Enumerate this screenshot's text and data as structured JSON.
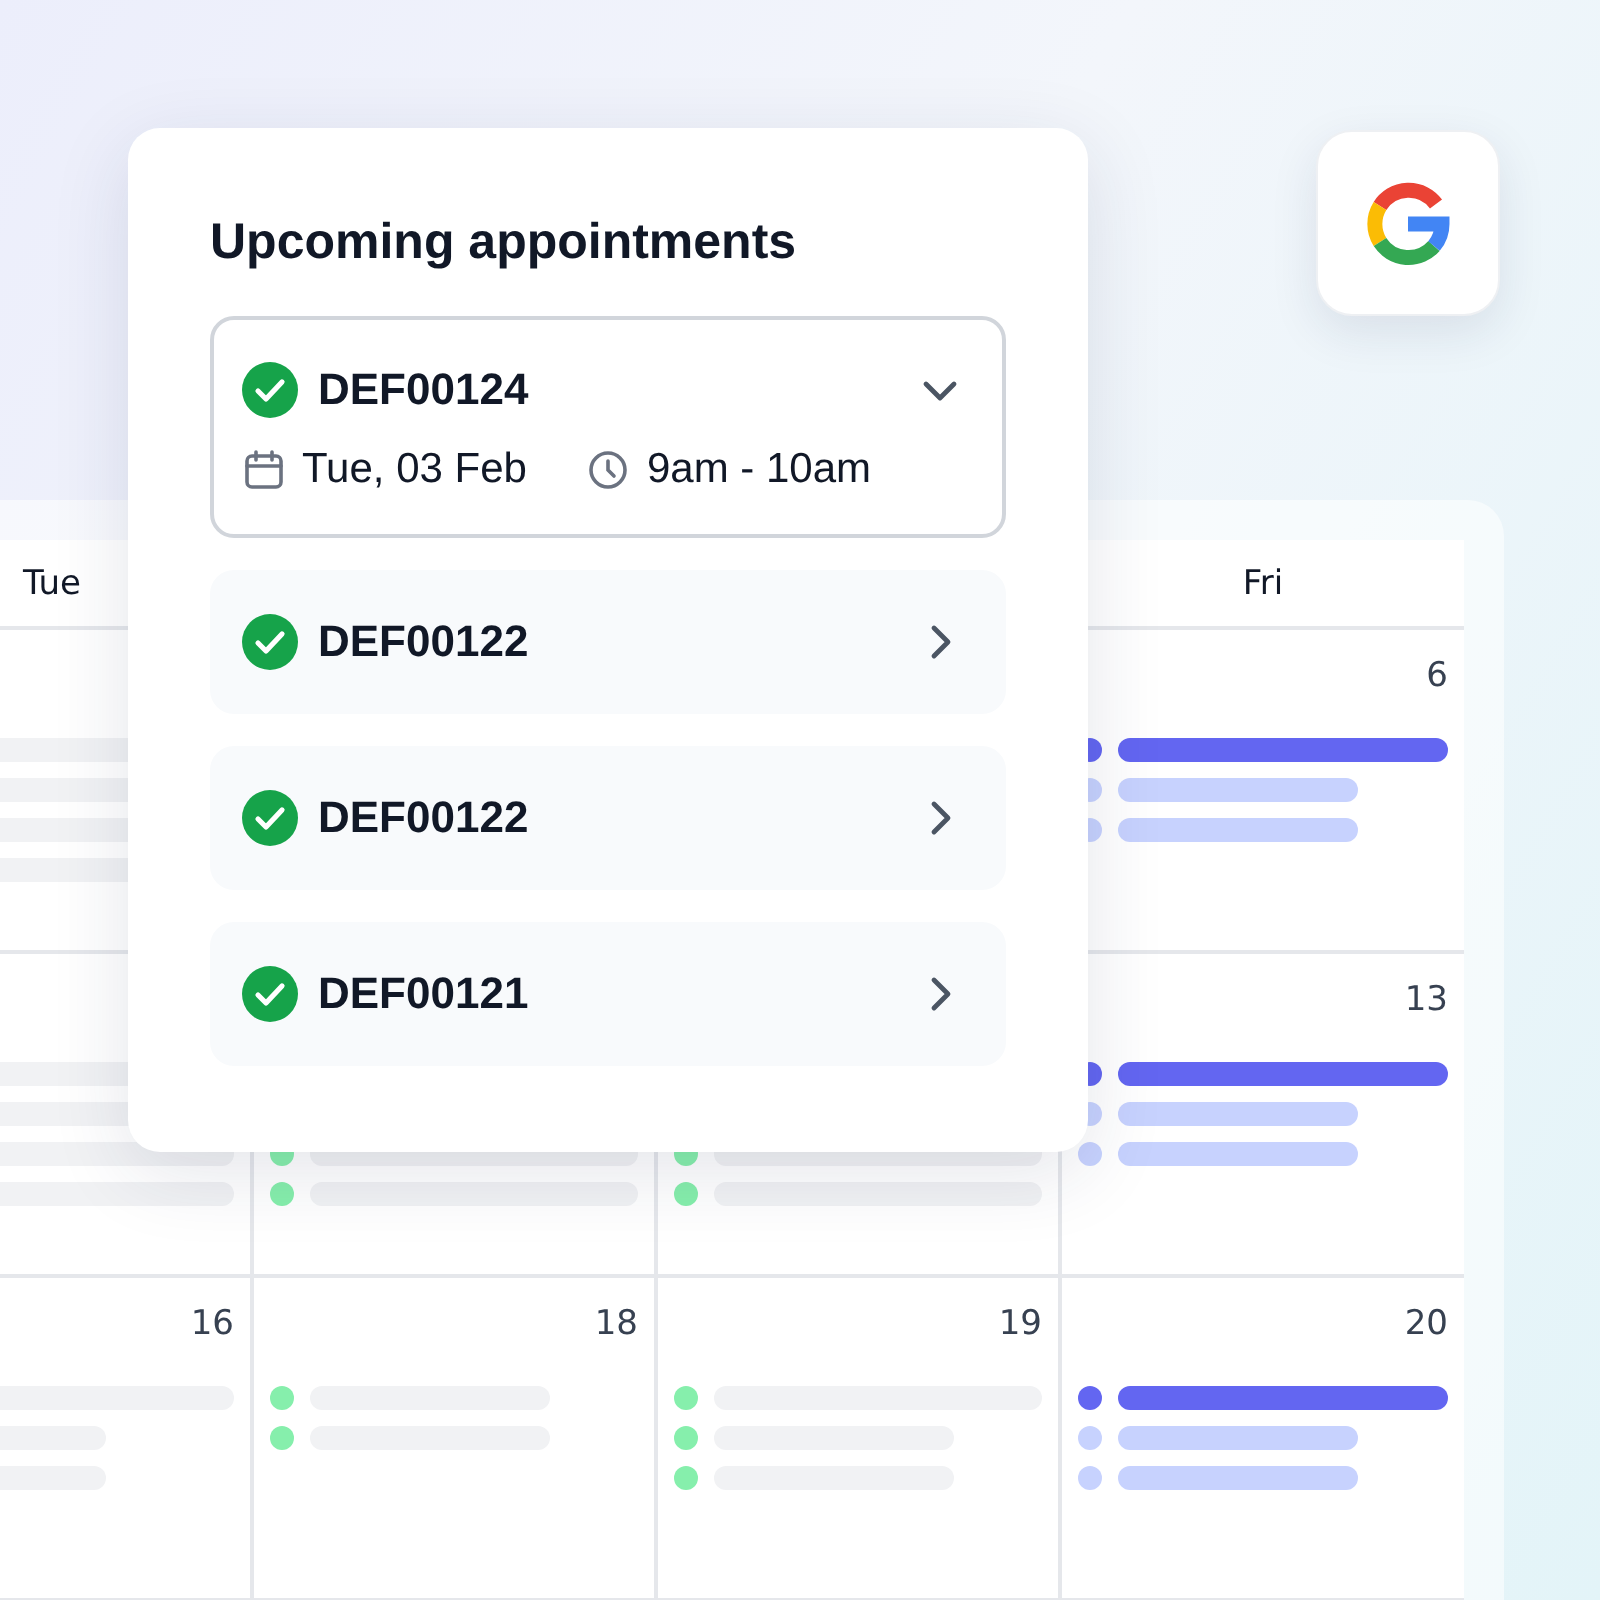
{
  "appointments": {
    "title": "Upcoming appointments",
    "items": [
      {
        "id": "DEF00124",
        "confirmed": true,
        "expanded": true,
        "date": "Tue, 03 Feb",
        "time": "9am - 10am"
      },
      {
        "id": "DEF00122",
        "confirmed": true,
        "expanded": false
      },
      {
        "id": "DEF00122",
        "confirmed": true,
        "expanded": false
      },
      {
        "id": "DEF00121",
        "confirmed": true,
        "expanded": false
      }
    ]
  },
  "calendar": {
    "days": {
      "column_1": "Tue",
      "column_4": "Fri"
    },
    "weeks": [
      {
        "column_1": {
          "events": [
            {
              "kind": "plain",
              "long": true
            },
            {
              "kind": "plain",
              "long": true
            },
            {
              "kind": "plain",
              "long": true
            },
            {
              "kind": "plain",
              "long": true
            }
          ]
        },
        "column_4": {
          "date": "6",
          "events": [
            {
              "color": "#6366f1",
              "kind": "accent",
              "long": true
            },
            {
              "color": "#c7d2fe",
              "kind": "accent",
              "long": false
            },
            {
              "color": "#c7d2fe",
              "kind": "accent",
              "long": false
            }
          ]
        }
      },
      {
        "column_1": {
          "events": [
            {
              "kind": "plain",
              "long": true
            },
            {
              "kind": "plain",
              "long": true
            },
            {
              "kind": "plain",
              "long": true
            },
            {
              "kind": "plain",
              "long": true
            }
          ]
        },
        "column_2": {
          "events": [
            {
              "color": "#86efac",
              "kind": "plain",
              "long": true
            },
            {
              "color": "#86efac",
              "kind": "plain",
              "long": true
            }
          ]
        },
        "column_3": {
          "events": [
            {
              "color": "#86efac",
              "kind": "plain",
              "long": true
            },
            {
              "color": "#86efac",
              "kind": "plain",
              "long": true
            }
          ]
        },
        "column_4": {
          "date": "13",
          "events": [
            {
              "color": "#6366f1",
              "kind": "accent",
              "long": true
            },
            {
              "color": "#c7d2fe",
              "kind": "accent",
              "long": false
            },
            {
              "color": "#c7d2fe",
              "kind": "accent",
              "long": false
            }
          ]
        }
      },
      {
        "column_1": {
          "date": "16",
          "events": [
            {
              "kind": "plain",
              "long": true
            },
            {
              "kind": "plain",
              "long": false
            },
            {
              "kind": "plain",
              "long": false
            }
          ]
        },
        "column_2": {
          "date": "18",
          "events": [
            {
              "color": "#86efac",
              "kind": "plain",
              "long": false
            },
            {
              "color": "#86efac",
              "kind": "plain",
              "long": false
            }
          ]
        },
        "column_3": {
          "date": "19",
          "events": [
            {
              "color": "#86efac",
              "kind": "plain",
              "long": true
            },
            {
              "color": "#86efac",
              "kind": "plain",
              "long": false
            },
            {
              "color": "#86efac",
              "kind": "plain",
              "long": false
            }
          ]
        },
        "column_4": {
          "date": "20",
          "events": [
            {
              "color": "#6366f1",
              "kind": "accent",
              "long": true
            },
            {
              "color": "#c7d2fe",
              "kind": "accent",
              "long": false
            },
            {
              "color": "#c7d2fe",
              "kind": "accent",
              "long": false
            }
          ]
        }
      }
    ]
  }
}
